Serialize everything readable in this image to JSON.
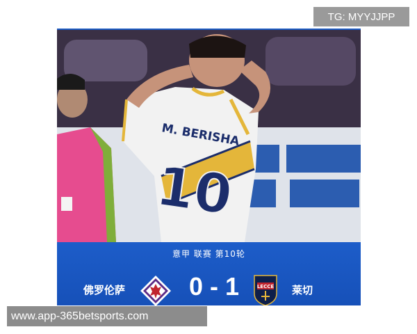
{
  "watermark_top": "TG: MYYJJPP",
  "jersey_name": "M. BERISHA",
  "jersey_number": "10",
  "match": {
    "round": "意甲 联赛 第10轮",
    "home_team": "佛罗伦萨",
    "away_team": "莱切",
    "score": "0 - 1"
  },
  "lecce_badge_text": "LECCE",
  "watermark_bottom": "www.app-365betsports.com",
  "colors": {
    "scorebar": "#1a56c0",
    "fiorentina_purple": "#5b2a86",
    "lecce_navy": "#0e1f4a"
  }
}
